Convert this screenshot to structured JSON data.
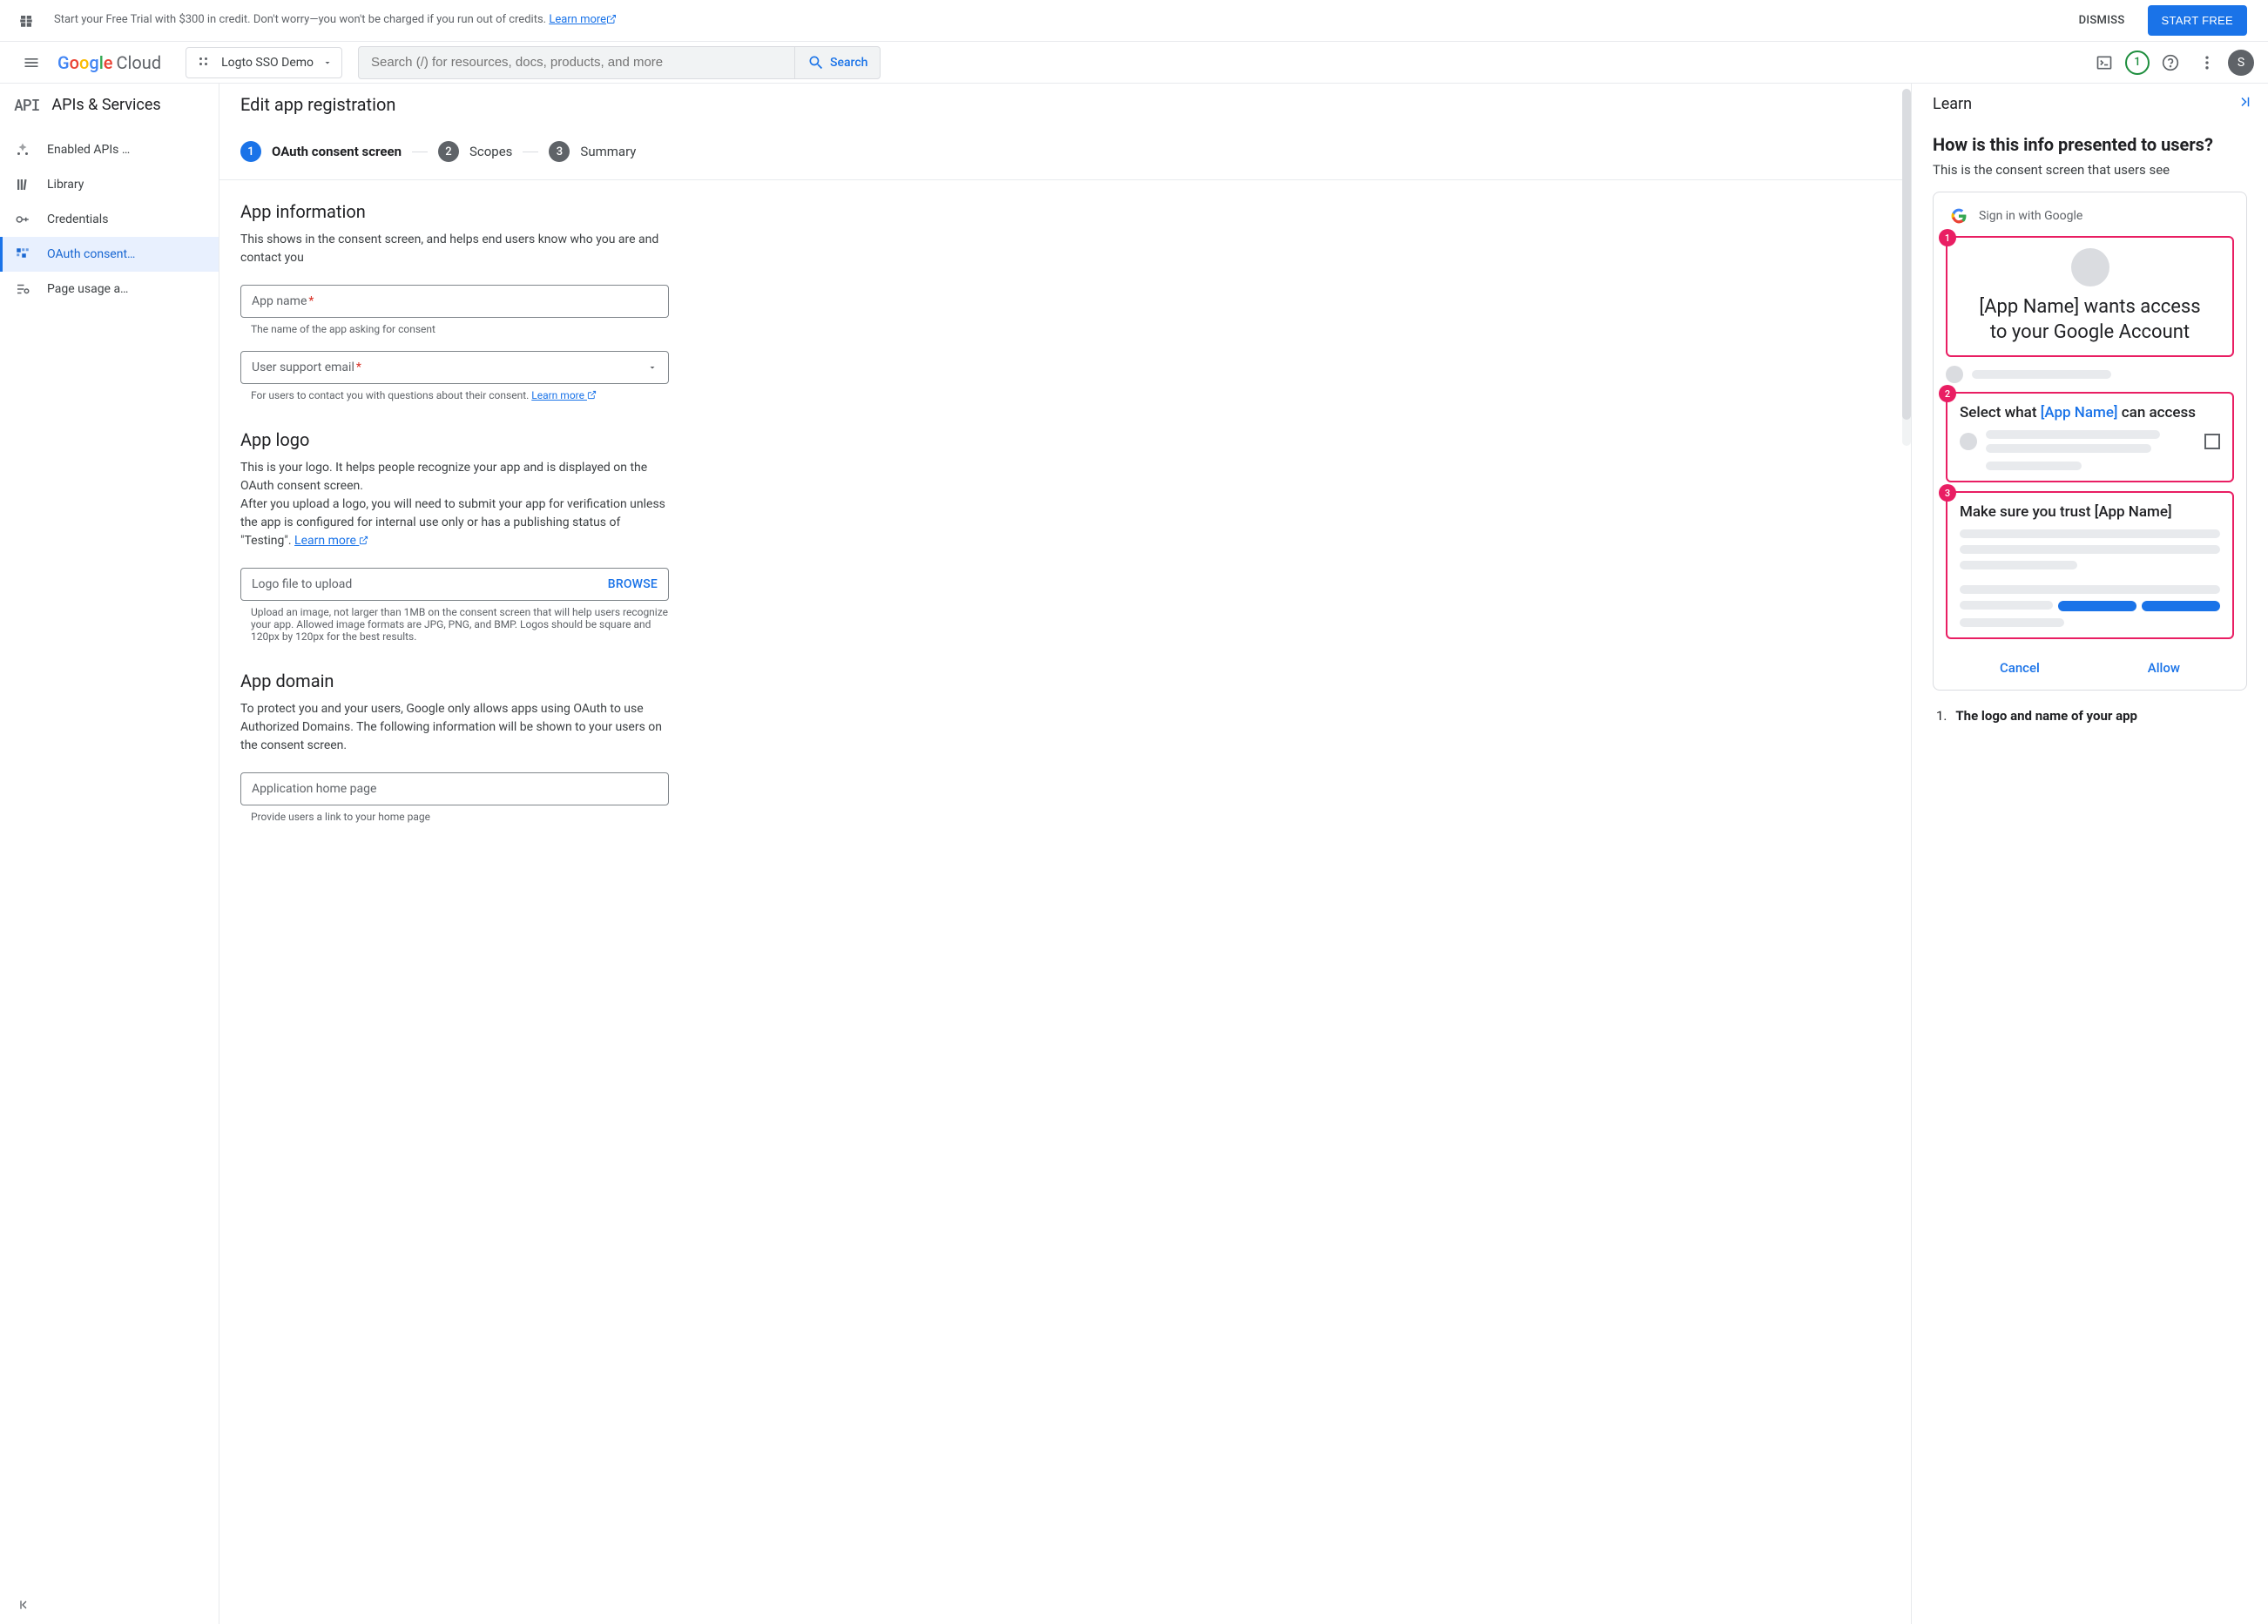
{
  "promo": {
    "text": "Start your Free Trial with $300 in credit. Don't worry—you won't be charged if you run out of credits. ",
    "learn_more": "Learn more",
    "dismiss": "DISMISS",
    "start_free": "START FREE"
  },
  "header": {
    "logo_cloud": "Cloud",
    "project_name": "Logto SSO Demo",
    "search_placeholder": "Search (/) for resources, docs, products, and more",
    "search_btn": "Search",
    "trial_badge": "1",
    "avatar_initial": "S"
  },
  "sidebar": {
    "api_logo": "API",
    "title": "APIs & Services",
    "items": [
      {
        "label": "Enabled APIs …"
      },
      {
        "label": "Library"
      },
      {
        "label": "Credentials"
      },
      {
        "label": "OAuth consent…"
      },
      {
        "label": "Page usage a…"
      }
    ]
  },
  "main": {
    "title": "Edit app registration",
    "steps": [
      {
        "num": "1",
        "label": "OAuth consent screen"
      },
      {
        "num": "2",
        "label": "Scopes"
      },
      {
        "num": "3",
        "label": "Summary"
      }
    ],
    "sections": {
      "app_info": {
        "title": "App information",
        "desc": "This shows in the consent screen, and helps end users know who you are and contact you",
        "app_name_placeholder": "App name",
        "app_name_helper": "The name of the app asking for consent",
        "support_email_placeholder": "User support email",
        "support_email_helper": "For users to contact you with questions about their consent. ",
        "learn_more": "Learn more"
      },
      "app_logo": {
        "title": "App logo",
        "desc1": "This is your logo. It helps people recognize your app and is displayed on the OAuth consent screen.",
        "desc2": "After you upload a logo, you will need to submit your app for verification unless the app is configured for internal use only or has a publishing status of \"Testing\". ",
        "learn_more": "Learn more",
        "upload_placeholder": "Logo file to upload",
        "browse": "BROWSE",
        "upload_helper": "Upload an image, not larger than 1MB on the consent screen that will help users recognize your app. Allowed image formats are JPG, PNG, and BMP. Logos should be square and 120px by 120px for the best results."
      },
      "app_domain": {
        "title": "App domain",
        "desc": "To protect you and your users, Google only allows apps using OAuth to use Authorized Domains. The following information will be shown to your users on the consent screen.",
        "home_page_placeholder": "Application home page",
        "home_page_helper": "Provide users a link to your home page"
      }
    }
  },
  "learn": {
    "title": "Learn",
    "h2": "How is this info presented to users?",
    "p": "This is the consent screen that users see",
    "mock": {
      "signin": "Sign in with Google",
      "wants_access_l1": "[App Name] wants access",
      "wants_access_l2": "to your Google Account",
      "select_pre": "Select what ",
      "select_appname": "[App Name]",
      "select_post": " can access",
      "trust": "Make sure you trust [App Name]",
      "cancel": "Cancel",
      "allow": "Allow"
    },
    "list": [
      {
        "num": "1.",
        "text": "The logo and name of your app"
      }
    ]
  }
}
